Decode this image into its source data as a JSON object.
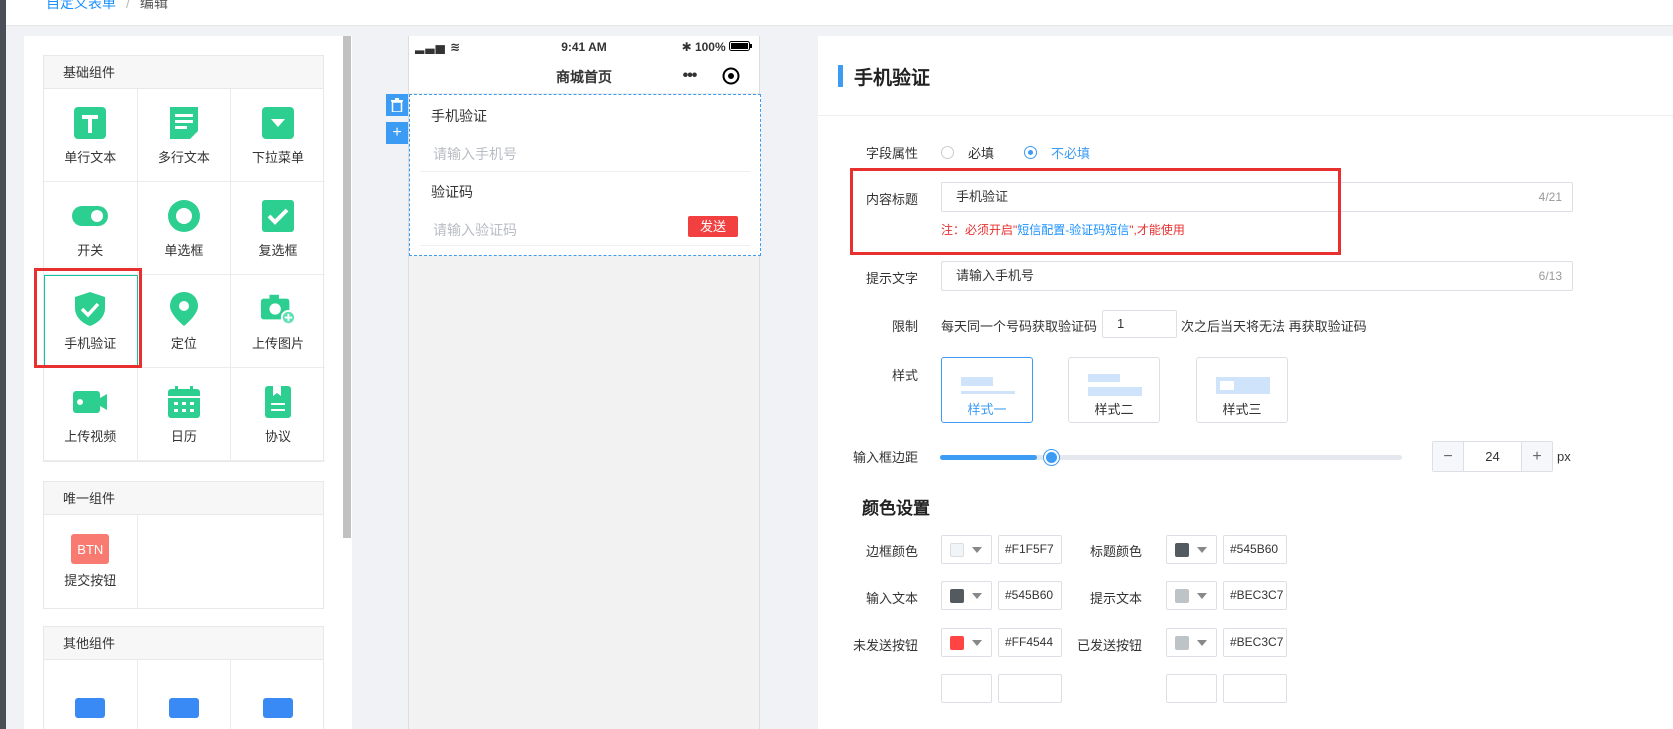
{
  "breadcrumb": {
    "parent": "自定义表单",
    "separator": "/",
    "current": "编辑"
  },
  "components": {
    "basic": {
      "title": "基础组件",
      "items": [
        {
          "label": "单行文本",
          "icon": "single-line-text-icon"
        },
        {
          "label": "多行文本",
          "icon": "multi-line-text-icon"
        },
        {
          "label": "下拉菜单",
          "icon": "dropdown-icon"
        },
        {
          "label": "开关",
          "icon": "switch-icon"
        },
        {
          "label": "单选框",
          "icon": "radio-icon"
        },
        {
          "label": "复选框",
          "icon": "checkbox-icon"
        },
        {
          "label": "手机验证",
          "icon": "phone-verify-shield-icon"
        },
        {
          "label": "定位",
          "icon": "location-pin-icon"
        },
        {
          "label": "上传图片",
          "icon": "upload-image-icon"
        },
        {
          "label": "上传视频",
          "icon": "upload-video-icon"
        },
        {
          "label": "日历",
          "icon": "calendar-icon"
        },
        {
          "label": "协议",
          "icon": "agreement-icon"
        }
      ]
    },
    "unique": {
      "title": "唯一组件",
      "items": [
        {
          "label": "提交按钮",
          "badge": "BTN"
        }
      ]
    },
    "other": {
      "title": "其他组件"
    }
  },
  "phone": {
    "time": "9:41 AM",
    "battery": "100%",
    "nav_title": "商城首页",
    "form": {
      "phone_label": "手机验证",
      "phone_placeholder": "请输入手机号",
      "code_label": "验证码",
      "code_placeholder": "请输入验证码",
      "send_label": "发送"
    }
  },
  "props": {
    "title": "手机验证",
    "field_attr": {
      "label": "字段属性",
      "required": "必填",
      "optional": "不必填"
    },
    "content_title": {
      "label": "内容标题",
      "value": "手机验证",
      "count": "4/21"
    },
    "note": {
      "prefix": "注：必须开启\"",
      "link": "短信配置-验证码短信",
      "suffix": "\",才能使用"
    },
    "hint_text": {
      "label": "提示文字",
      "value": "请输入手机号",
      "count": "6/13"
    },
    "limit": {
      "label": "限制",
      "before": "每天同一个号码获取验证码",
      "value": "1",
      "after": "次之后当天将无法 再获取验证码"
    },
    "style": {
      "label": "样式",
      "options": [
        "样式一",
        "样式二",
        "样式三"
      ]
    },
    "margin": {
      "label": "输入框边距",
      "value": "24",
      "level": 0.21,
      "unit": "px"
    },
    "colors": {
      "title": "颜色设置",
      "border": {
        "label": "边框颜色",
        "hex": "#F1F5F7"
      },
      "title_color": {
        "label": "标题颜色",
        "hex": "#545B60"
      },
      "input_text": {
        "label": "输入文本",
        "hex": "#545B60"
      },
      "hint": {
        "label": "提示文本",
        "hex": "#BEC3C7"
      },
      "unsent": {
        "label": "未发送按钮",
        "hex": "#FF4544"
      },
      "sent": {
        "label": "已发送按钮",
        "hex": "#BEC3C7"
      }
    }
  }
}
